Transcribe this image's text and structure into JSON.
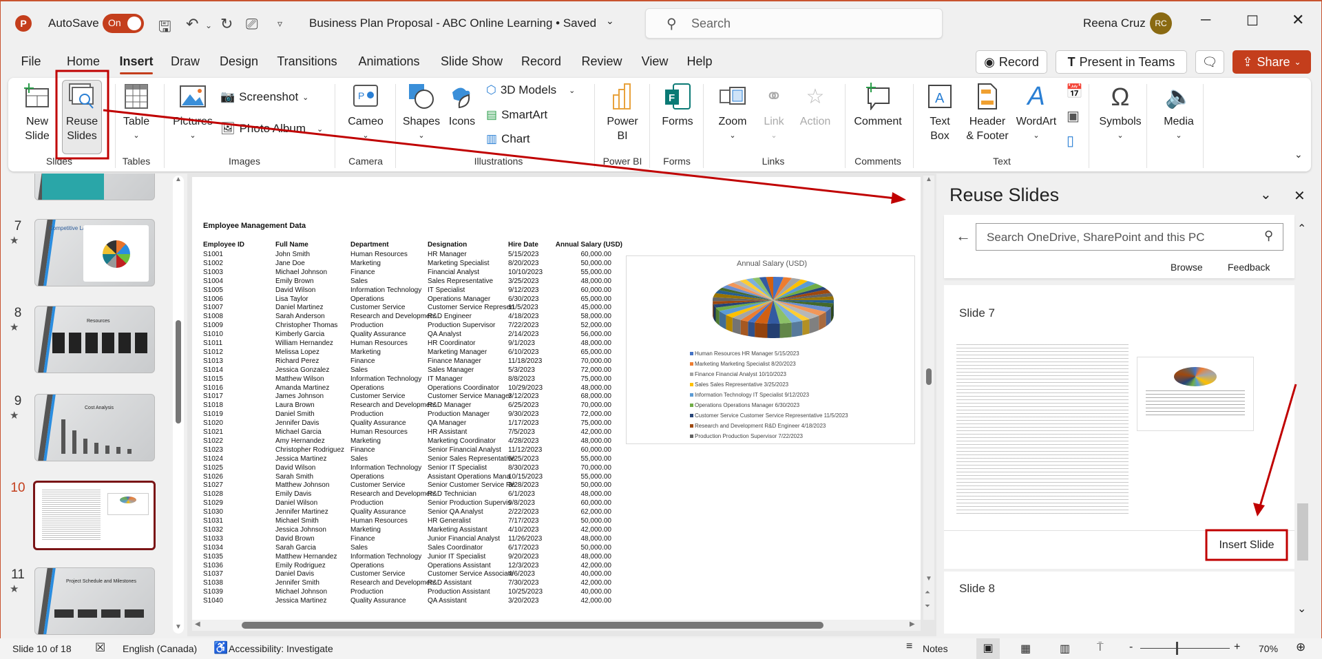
{
  "titlebar": {
    "autosave_label": "AutoSave",
    "autosave_state": "On",
    "doc_title": "Business Plan Proposal - ABC Online Learning • Saved",
    "search_placeholder": "Search",
    "user_name": "Reena Cruz",
    "user_initials": "RC"
  },
  "tabs": [
    "File",
    "Home",
    "Insert",
    "Draw",
    "Design",
    "Transitions",
    "Animations",
    "Slide Show",
    "Record",
    "Review",
    "View",
    "Help"
  ],
  "active_tab": "Insert",
  "top_buttons": {
    "record": "Record",
    "present": "Present in Teams",
    "share": "Share"
  },
  "ribbon": {
    "new_slide": [
      "New",
      "Slide"
    ],
    "reuse_slides": [
      "Reuse",
      "Slides"
    ],
    "table": "Table",
    "pictures": "Pictures",
    "screenshot": "Screenshot",
    "photo_album": "Photo Album",
    "cameo": "Cameo",
    "shapes": "Shapes",
    "icons": "Icons",
    "models3d": "3D Models",
    "smartart": "SmartArt",
    "chart": "Chart",
    "powerbi": [
      "Power",
      "BI"
    ],
    "forms": "Forms",
    "zoom": "Zoom",
    "link": "Link",
    "action": "Action",
    "comment": "Comment",
    "textbox": [
      "Text",
      "Box"
    ],
    "header_footer": [
      "Header",
      "& Footer"
    ],
    "wordart": "WordArt",
    "symbols": "Symbols",
    "media": "Media",
    "groups": {
      "slides": "Slides",
      "tables": "Tables",
      "images": "Images",
      "camera": "Camera",
      "illustrations": "Illustrations",
      "powerbi": "Power BI",
      "forms": "Forms",
      "links": "Links",
      "comments": "Comments",
      "text": "Text"
    }
  },
  "thumbnails": [
    {
      "num": "7",
      "title": "Competitive Landscape:"
    },
    {
      "num": "8",
      "title": "Resources"
    },
    {
      "num": "9",
      "title": "Cost Analysis"
    },
    {
      "num": "10",
      "title": ""
    },
    {
      "num": "11",
      "title": "Project Schedule and Milestones"
    }
  ],
  "slide": {
    "title": "Employee Management Data",
    "headers": [
      "Employee ID",
      "Full  Name",
      "Department",
      "Designation",
      "Hire Date",
      "Annual Salary (USD)"
    ],
    "rows": [
      [
        "S1001",
        "John  Smith",
        "Human Resources",
        "HR Manager",
        "5/15/2023",
        "60,000.00"
      ],
      [
        "S1002",
        "Jane Doe",
        "Marketing",
        "Marketing Specialist",
        "8/20/2023",
        "50,000.00"
      ],
      [
        "S1003",
        "Michael Johnson",
        "Finance",
        "Financial Analyst",
        "10/10/2023",
        "55,000.00"
      ],
      [
        "S1004",
        "Emily Brown",
        "Sales",
        "Sales Representative",
        "3/25/2023",
        "48,000.00"
      ],
      [
        "S1005",
        "David Wilson",
        "Information Technology",
        "IT Specialist",
        "9/12/2023",
        "60,000.00"
      ],
      [
        "S1006",
        "Lisa Taylor",
        "Operations",
        "Operations Manager",
        "6/30/2023",
        "65,000.00"
      ],
      [
        "S1007",
        "Daniel Martinez",
        "Customer Service",
        "Customer Service Represen",
        "11/5/2023",
        "45,000.00"
      ],
      [
        "S1008",
        "Sarah Anderson",
        "Research and Developmen",
        "R&D Engineer",
        "4/18/2023",
        "58,000.00"
      ],
      [
        "S1009",
        "Christopher Thomas",
        "Production",
        "Production Supervisor",
        "7/22/2023",
        "52,000.00"
      ],
      [
        "S1010",
        "Kimberly Garcia",
        "Quality Assurance",
        "QA Analyst",
        "2/14/2023",
        "56,000.00"
      ],
      [
        "S1011",
        "William Hernandez",
        "Human Resources",
        "HR Coordinator",
        "9/1/2023",
        "48,000.00"
      ],
      [
        "S1012",
        "Melissa Lopez",
        "Marketing",
        "Marketing Manager",
        "6/10/2023",
        "65,000.00"
      ],
      [
        "S1013",
        "Richard Perez",
        "Finance",
        "Finance Manager",
        "11/18/2023",
        "70,000.00"
      ],
      [
        "S1014",
        "Jessica Gonzalez",
        "Sales",
        "Sales Manager",
        "5/3/2023",
        "72,000.00"
      ],
      [
        "S1015",
        "Matthew Wilson",
        "Information Technology",
        "IT Manager",
        "8/8/2023",
        "75,000.00"
      ],
      [
        "S1016",
        "Amanda Martinez",
        "Operations",
        "Operations Coordinator",
        "10/29/2023",
        "48,000.00"
      ],
      [
        "S1017",
        "James Johnson",
        "Customer Service",
        "Customer Service Manager",
        "3/12/2023",
        "68,000.00"
      ],
      [
        "S1018",
        "Laura Brown",
        "Research and Developmen",
        "R&D Manager",
        "6/25/2023",
        "70,000.00"
      ],
      [
        "S1019",
        "Daniel Smith",
        "Production",
        "Production Manager",
        "9/30/2023",
        "72,000.00"
      ],
      [
        "S1020",
        "Jennifer Davis",
        "Quality Assurance",
        "QA Manager",
        "1/17/2023",
        "75,000.00"
      ],
      [
        "S1021",
        "Michael Garcia",
        "Human Resources",
        "HR Assistant",
        "7/5/2023",
        "42,000.00"
      ],
      [
        "S1022",
        "Amy Hernandez",
        "Marketing",
        "Marketing Coordinator",
        "4/28/2023",
        "48,000.00"
      ],
      [
        "S1023",
        "Christopher Rodriguez",
        "Finance",
        "Senior Financial Analyst",
        "11/12/2023",
        "60,000.00"
      ],
      [
        "S1024",
        "Jessica Martinez",
        "Sales",
        "Senior Sales Representative",
        "5/25/2023",
        "55,000.00"
      ],
      [
        "S1025",
        "David Wilson",
        "Information Technology",
        "Senior IT Specialist",
        "8/30/2023",
        "70,000.00"
      ],
      [
        "S1026",
        "Sarah Smith",
        "Operations",
        "Assistant Operations Mana",
        "10/15/2023",
        "55,000.00"
      ],
      [
        "S1027",
        "Matthew Johnson",
        "Customer Service",
        "Senior Customer Service Re",
        "3/28/2023",
        "50,000.00"
      ],
      [
        "S1028",
        "Emily Davis",
        "Research and Developmen",
        "R&D Technician",
        "6/1/2023",
        "48,000.00"
      ],
      [
        "S1029",
        "Daniel Wilson",
        "Production",
        "Senior Production Supervis",
        "9/8/2023",
        "60,000.00"
      ],
      [
        "S1030",
        "Jennifer Martinez",
        "Quality Assurance",
        "Senior QA Analyst",
        "2/22/2023",
        "62,000.00"
      ],
      [
        "S1031",
        "Michael Smith",
        "Human Resources",
        "HR Generalist",
        "7/17/2023",
        "50,000.00"
      ],
      [
        "S1032",
        "Jessica Johnson",
        "Marketing",
        "Marketing Assistant",
        "4/10/2023",
        "42,000.00"
      ],
      [
        "S1033",
        "David Brown",
        "Finance",
        "Junior Financial Analyst",
        "11/26/2023",
        "48,000.00"
      ],
      [
        "S1034",
        "Sarah Garcia",
        "Sales",
        "Sales Coordinator",
        "6/17/2023",
        "50,000.00"
      ],
      [
        "S1035",
        "Matthew Hernandez",
        "Information Technology",
        "Junior IT Specialist",
        "9/20/2023",
        "48,000.00"
      ],
      [
        "S1036",
        "Emily Rodriguez",
        "Operations",
        "Operations Assistant",
        "12/3/2023",
        "42,000.00"
      ],
      [
        "S1037",
        "Daniel Davis",
        "Customer Service",
        "Customer Service Associate",
        "4/6/2023",
        "40,000.00"
      ],
      [
        "S1038",
        "Jennifer Smith",
        "Research and Developmen",
        "R&D Assistant",
        "7/30/2023",
        "42,000.00"
      ],
      [
        "S1039",
        "Michael Johnson",
        "Production",
        "Production Assistant",
        "10/25/2023",
        "40,000.00"
      ],
      [
        "S1040",
        "Jessica Martinez",
        "Quality Assurance",
        "QA Assistant",
        "3/20/2023",
        "42,000.00"
      ]
    ]
  },
  "chart_data": {
    "type": "pie",
    "title": "Annual Salary (USD)",
    "legend_position": "bottom",
    "legend": [
      "Human Resources HR Manager 5/15/2023",
      "Marketing Marketing Specialist 8/20/2023",
      "Finance Financial Analyst 10/10/2023",
      "Sales Sales Representative 3/25/2023",
      "Information Technology IT Specialist 9/12/2023",
      "Operations Operations Manager 6/30/2023",
      "Customer Service Customer Service Representative 11/5/2023",
      "Research and Development R&D Engineer 4/18/2023",
      "Production Production Supervisor 7/22/2023"
    ],
    "values": [
      60000,
      50000,
      55000,
      48000,
      60000,
      65000,
      45000,
      58000,
      52000,
      56000,
      48000,
      65000,
      70000,
      72000,
      75000,
      48000,
      68000,
      70000,
      72000,
      75000,
      42000,
      48000,
      60000,
      55000,
      70000,
      55000,
      50000,
      48000,
      60000,
      62000,
      50000,
      42000,
      48000,
      50000,
      48000,
      42000,
      40000,
      42000,
      40000,
      42000
    ],
    "colors": [
      "#4472C4",
      "#ED7D31",
      "#A5A5A5",
      "#FFC000",
      "#5B9BD5",
      "#70AD47",
      "#264478",
      "#9E480E",
      "#636363",
      "#997300",
      "#255E91",
      "#43682B",
      "#698ED0",
      "#F1975A",
      "#B7B7B7",
      "#FFCD33",
      "#7CAFDD",
      "#8CC168",
      "#335AA1",
      "#D26012"
    ]
  },
  "reuse_panel": {
    "title": "Reuse Slides",
    "search_placeholder": "Search OneDrive, SharePoint and this PC",
    "browse": "Browse",
    "feedback": "Feedback",
    "slide_label": "Slide 7",
    "insert_button": "Insert Slide",
    "next_slide_label": "Slide 8"
  },
  "status": {
    "slide_info": "Slide 10 of 18",
    "language": "English (Canada)",
    "accessibility": "Accessibility: Investigate",
    "notes": "Notes",
    "zoom": "70%",
    "zoom_fraction": 0.4
  },
  "annotation_color": "#C00000"
}
